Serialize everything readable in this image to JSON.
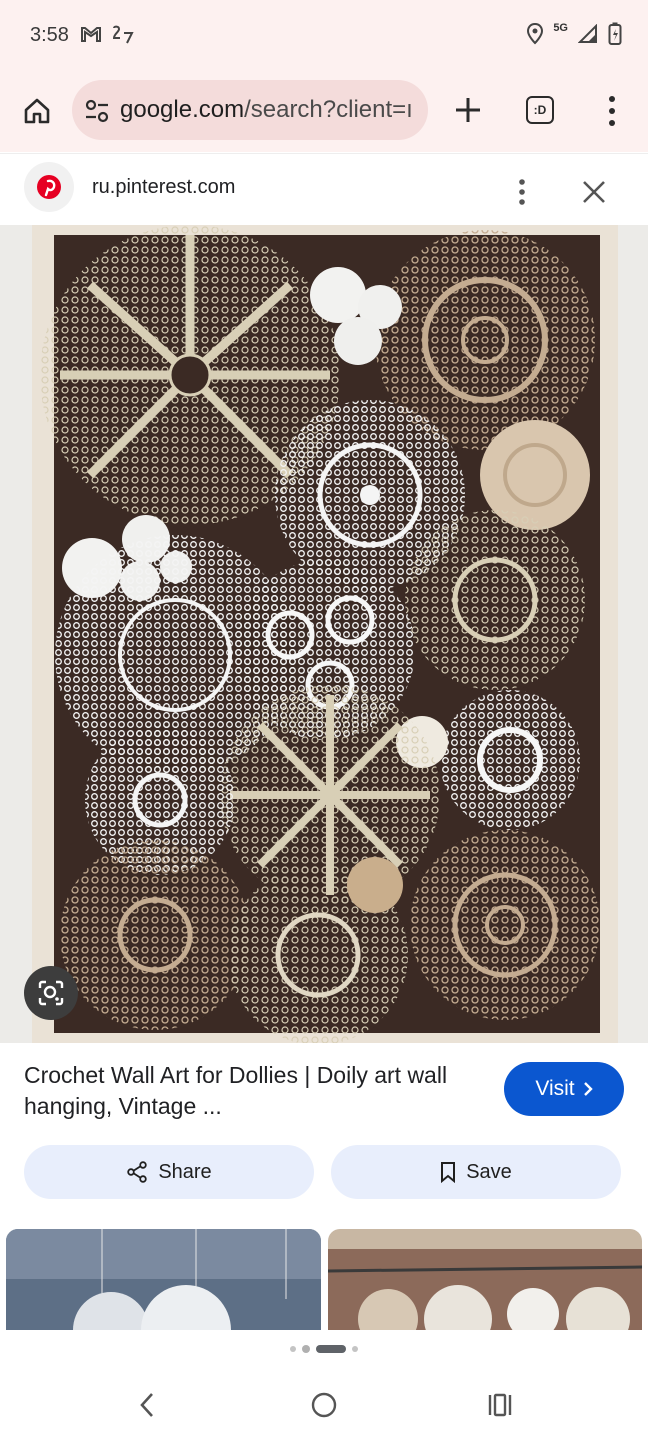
{
  "status": {
    "time": "3:58",
    "network": "5G",
    "icons": [
      "gmail-icon",
      "data-transfer-icon",
      "location-icon",
      "signal-icon",
      "battery-charging-icon"
    ]
  },
  "browser": {
    "url_host": "google.com",
    "url_path": "/search?client=ı",
    "tab_count": ":D",
    "icons": [
      "home-icon",
      "site-settings-icon",
      "new-tab-icon",
      "tab-switcher-icon",
      "overflow-menu-icon"
    ]
  },
  "source": {
    "site": "ru.pinterest.com",
    "logo": "pinterest-logo-icon"
  },
  "result": {
    "title": "Crochet Wall Art for Dollies | Doily art wall hanging, Vintage ...",
    "visit_label": "Visit",
    "share_label": "Share",
    "save_label": "Save"
  },
  "colors": {
    "accent": "#0b57d0",
    "chrome_bg": "#fdf1f0",
    "omnibox_bg": "#f4dcdb",
    "chip_bg": "#e8eefc"
  },
  "pager": {
    "total": 4,
    "active": 3
  }
}
